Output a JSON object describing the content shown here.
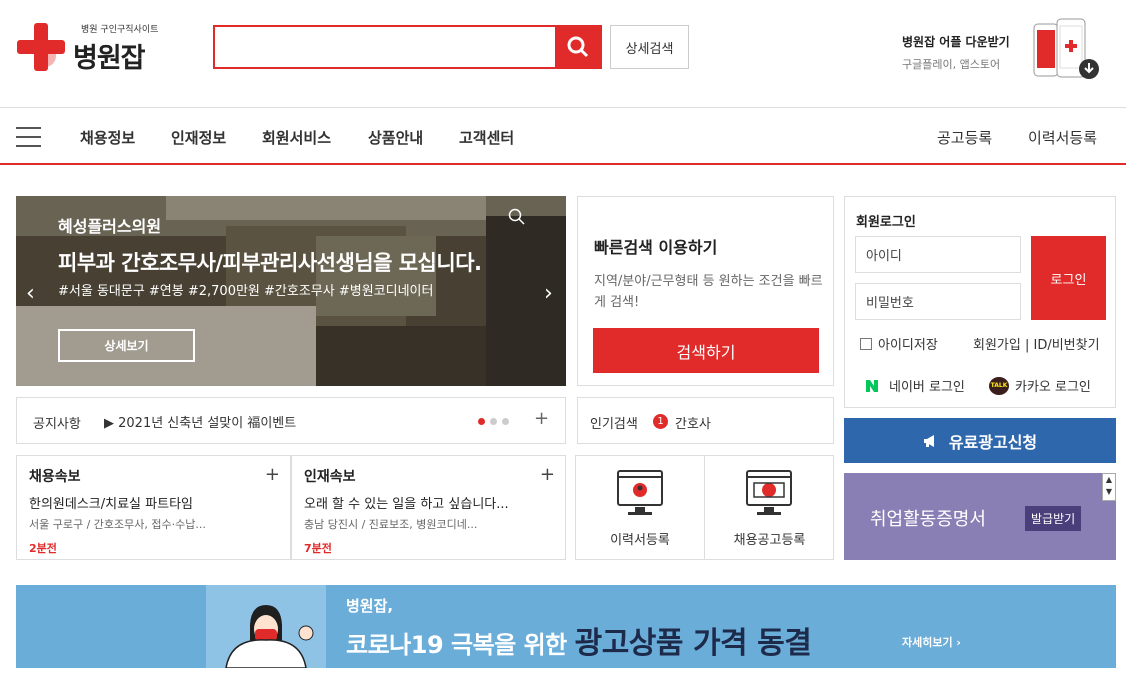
{
  "header": {
    "logo_tag": "병원 구인구직사이트",
    "logo_name": "병원잡",
    "search_placeholder": "",
    "adv_search": "상세검색",
    "app_title": "병원잡 어플 다운받기",
    "app_sub": "구글플레이, 앱스토어"
  },
  "nav": {
    "items": [
      "채용정보",
      "인재정보",
      "회원서비스",
      "상품안내",
      "고객센터"
    ],
    "right": [
      "공고등록",
      "이력서등록"
    ]
  },
  "banner": {
    "hospital": "혜성플러스의원",
    "title": "피부과 간호조무사/피부관리사선생님을 모십니다.",
    "tags": "#서울 동대문구 #연봉 #2,700만원 #간호조무사 #병원코디네이터",
    "detail": "상세보기"
  },
  "quick": {
    "title": "빠른검색 이용하기",
    "desc": "지역/분야/근무형태 등 원하는 조건을 빠르게 검색!",
    "button": "검색하기"
  },
  "login": {
    "title": "회원로그인",
    "id": "아이디",
    "pw": "비밀번호",
    "button": "로그인",
    "save": "아이디저장",
    "join": "회원가입 | ID/비번찾기",
    "naver": "네이버 로그인",
    "kakao": "카카오 로그인",
    "kakao_badge": "TALK"
  },
  "notice": {
    "label": "공지사항",
    "item": "▶ 2021년 신축년 설맞이 福이벤트",
    "plus": "+"
  },
  "popular": {
    "label": "인기검색",
    "rank": "1",
    "keyword": "간호사"
  },
  "paid_ad": "유료광고신청",
  "jobs_news": {
    "title": "채용속보",
    "item": "한의원데스크/치료실 파트타임",
    "meta": "서울 구로구 / 간호조무사, 접수·수납...",
    "time": "2분전",
    "plus": "+"
  },
  "talent_news": {
    "title": "인재속보",
    "item": "오래 할 수 있는 일을 하고 싶습니다...",
    "meta": "충남 당진시 / 진료보조, 병원코디네...",
    "time": "7분전",
    "plus": "+"
  },
  "register": {
    "resume": "이력서등록",
    "job": "채용공고등록"
  },
  "cert": {
    "title": "취업활동증명서",
    "badge": "발급받기"
  },
  "ad": {
    "line1": "병원잡,",
    "line2a": "코로나19 극복을 위한 ",
    "line2b": "광고상품 가격 동결",
    "more": "자세히보기 ›"
  },
  "colors": {
    "brand": "#e12a2a",
    "blue": "#2f67ad",
    "purple": "#8a7fb5",
    "ad": "#6aadd9"
  }
}
